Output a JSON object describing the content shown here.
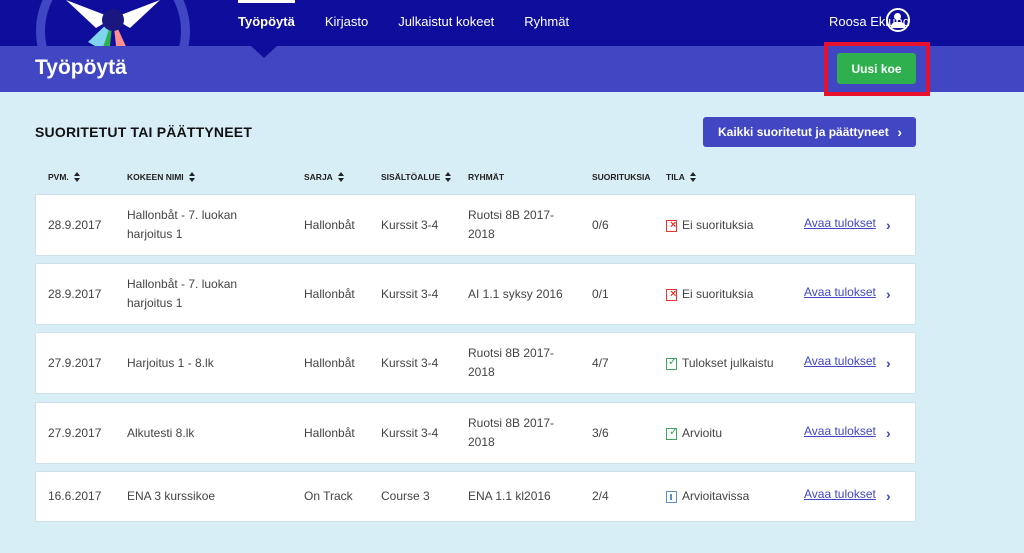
{
  "nav": {
    "items": [
      {
        "label": "Työpöytä",
        "active": true
      },
      {
        "label": "Kirjasto",
        "active": false
      },
      {
        "label": "Julkaistut kokeet",
        "active": false
      },
      {
        "label": "Ryhmät",
        "active": false
      }
    ],
    "user_name": "Roosa Eklund",
    "user_icon": "user-circle-icon"
  },
  "header": {
    "title": "Työpöytä",
    "new_exam_label": "Uusi koe"
  },
  "section": {
    "title": "SUORITETUT TAI PÄÄTTYNEET",
    "all_button_label": "Kaikki suoritetut ja päättyneet",
    "all_button_icon": "chevron-right-icon"
  },
  "table": {
    "columns": [
      "PVM.",
      "KOKEEN NIMI",
      "SARJA",
      "SISÄLTÖALUE",
      "RYHMÄT",
      "SUORITUKSIA",
      "TILA"
    ],
    "rows": [
      {
        "date": "28.9.2017",
        "name": "Hallonbåt - 7. luokan harjoitus 1",
        "series": "Hallonbåt",
        "content": "Kurssit 3-4",
        "groups": "Ruotsi 8B 2017-2018",
        "count": "0/6",
        "status": "Ei suorituksia",
        "status_icon": "no-submissions-icon",
        "link": "Avaa tulokset"
      },
      {
        "date": "28.9.2017",
        "name": "Hallonbåt - 7. luokan harjoitus 1",
        "series": "Hallonbåt",
        "content": "Kurssit 3-4",
        "groups": "AI 1.1 syksy 2016",
        "count": "0/1",
        "status": "Ei suorituksia",
        "status_icon": "no-submissions-icon",
        "link": "Avaa tulokset"
      },
      {
        "date": "27.9.2017",
        "name": "Harjoitus 1 - 8.lk",
        "series": "Hallonbåt",
        "content": "Kurssit 3-4",
        "groups": "Ruotsi 8B 2017-2018",
        "count": "4/7",
        "status": "Tulokset julkaistu",
        "status_icon": "published-icon",
        "link": "Avaa tulokset"
      },
      {
        "date": "27.9.2017",
        "name": "Alkutesti 8.lk",
        "series": "Hallonbåt",
        "content": "Kurssit 3-4",
        "groups": "Ruotsi 8B 2017-2018",
        "count": "3/6",
        "status": "Arvioitu",
        "status_icon": "graded-icon",
        "link": "Avaa tulokset"
      },
      {
        "date": "16.6.2017",
        "name": "ENA 3 kurssikoe",
        "series": "On Track",
        "content": "Course 3",
        "groups": "ENA 1.1 kl2016",
        "count": "2/4",
        "status": "Arvioitavissa",
        "status_icon": "pending-grading-icon",
        "link": "Avaa tulokset"
      }
    ]
  },
  "colors": {
    "nav_bg": "#0f0d9c",
    "header_bg": "#4146c2",
    "page_bg": "#d8eef6",
    "primary_button": "#2eb04f",
    "highlight_border": "#e8112d"
  }
}
